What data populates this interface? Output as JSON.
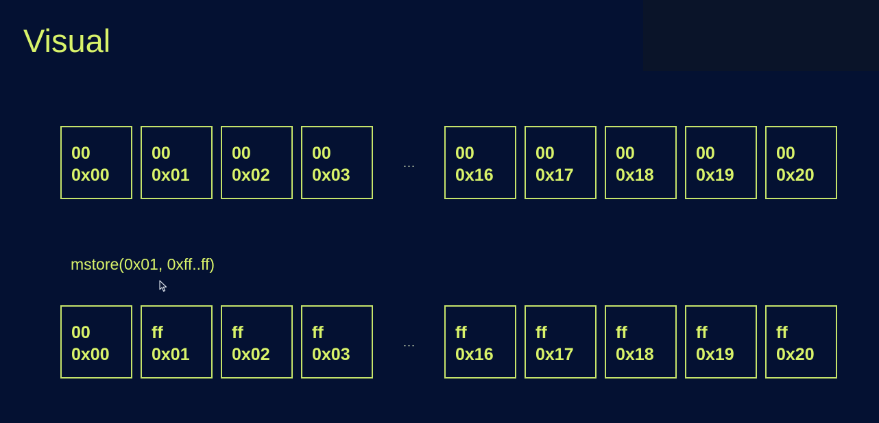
{
  "slide": {
    "title": "Visual",
    "command": "mstore(0x01, 0xff..ff)",
    "ellipsis": "...",
    "colors": {
      "background": "#041132",
      "accent": "#d9f36a",
      "border": "#c6e46a"
    }
  },
  "before": {
    "cells": [
      {
        "value": "00",
        "address": "0x00"
      },
      {
        "value": "00",
        "address": "0x01"
      },
      {
        "value": "00",
        "address": "0x02"
      },
      {
        "value": "00",
        "address": "0x03"
      },
      {
        "value": "00",
        "address": "0x16"
      },
      {
        "value": "00",
        "address": "0x17"
      },
      {
        "value": "00",
        "address": "0x18"
      },
      {
        "value": "00",
        "address": "0x19"
      },
      {
        "value": "00",
        "address": "0x20"
      }
    ]
  },
  "after": {
    "cells": [
      {
        "value": "00",
        "address": "0x00"
      },
      {
        "value": "ff",
        "address": "0x01"
      },
      {
        "value": "ff",
        "address": "0x02"
      },
      {
        "value": "ff",
        "address": "0x03"
      },
      {
        "value": "ff",
        "address": "0x16"
      },
      {
        "value": "ff",
        "address": "0x17"
      },
      {
        "value": "ff",
        "address": "0x18"
      },
      {
        "value": "ff",
        "address": "0x19"
      },
      {
        "value": "ff",
        "address": "0x20"
      }
    ]
  }
}
